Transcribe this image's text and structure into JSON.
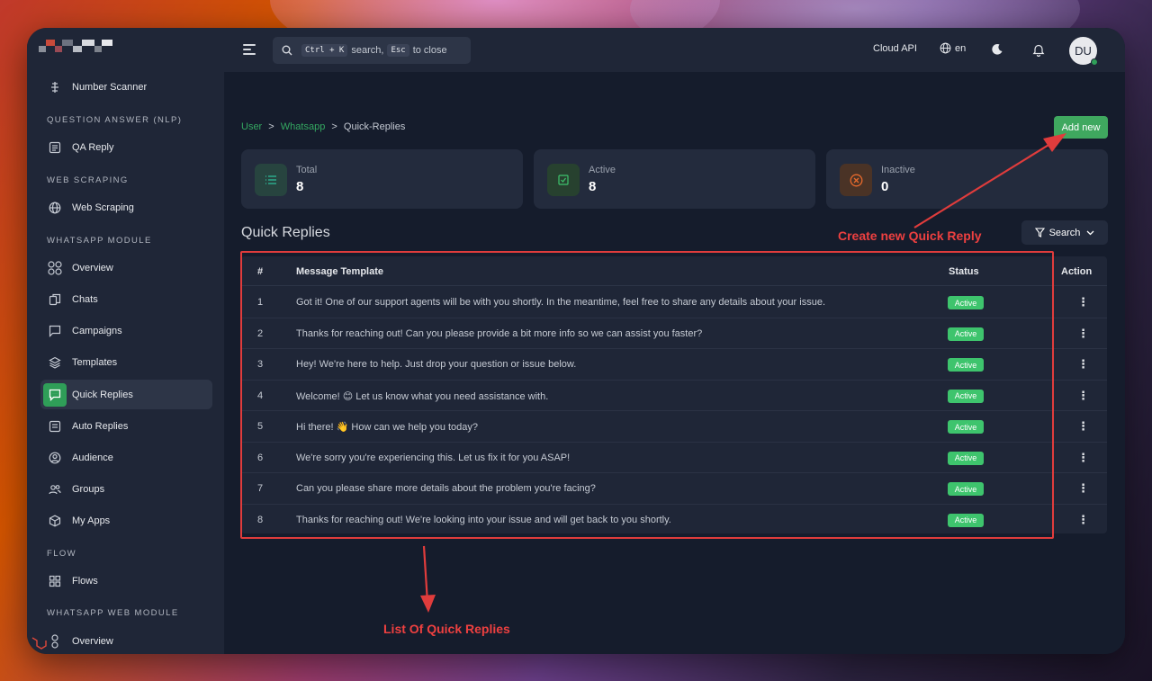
{
  "sidebar": {
    "items": [
      {
        "label": "Number Scanner",
        "icon": "scanner-icon"
      },
      {
        "label": "QA Reply",
        "icon": "document-icon"
      },
      {
        "label": "Web Scraping",
        "icon": "globe-icon"
      },
      {
        "label": "Overview",
        "icon": "grid-circles-icon"
      },
      {
        "label": "Chats",
        "icon": "chat-icon"
      },
      {
        "label": "Campaigns",
        "icon": "message-square-icon"
      },
      {
        "label": "Templates",
        "icon": "layers-icon"
      },
      {
        "label": "Quick Replies",
        "icon": "reply-icon"
      },
      {
        "label": "Auto Replies",
        "icon": "auto-reply-icon"
      },
      {
        "label": "Audience",
        "icon": "user-circle-icon"
      },
      {
        "label": "Groups",
        "icon": "users-icon"
      },
      {
        "label": "My Apps",
        "icon": "cube-icon"
      },
      {
        "label": "Flows",
        "icon": "grid-icon"
      },
      {
        "label": "Overview",
        "icon": "grid-circles-icon"
      }
    ],
    "headings": [
      "QUESTION ANSWER (NLP)",
      "WEB SCRAPING",
      "WHATSAPP MODULE",
      "FLOW",
      "WHATSAPP WEB MODULE"
    ]
  },
  "topbar": {
    "search_kbd1": "Ctrl + K",
    "search_text1": "search,",
    "search_kbd2": "Esc",
    "search_text2": "to close",
    "cloud_api": "Cloud API",
    "language": "en",
    "avatar": "DU"
  },
  "breadcrumb": {
    "user": "User",
    "whatsapp": "Whatsapp",
    "current": "Quick-Replies",
    "sep": ">"
  },
  "add_new": "Add new",
  "stats": [
    {
      "label": "Total",
      "value": "8",
      "color": "#2ec4a0"
    },
    {
      "label": "Active",
      "value": "8",
      "color": "#3ec46d"
    },
    {
      "label": "Inactive",
      "value": "0",
      "color": "#e86a2c"
    }
  ],
  "section_title": "Quick Replies",
  "filter_label": "Search",
  "table": {
    "headers": [
      "#",
      "Message Template",
      "Status",
      "Action"
    ],
    "rows": [
      {
        "num": "1",
        "msg": "Got it! One of our support agents will be with you shortly. In the meantime, feel free to share any details about your issue.",
        "status": "Active"
      },
      {
        "num": "2",
        "msg": "Thanks for reaching out! Can you please provide a bit more info so we can assist you faster?",
        "status": "Active"
      },
      {
        "num": "3",
        "msg": "Hey! We're here to help. Just drop your question or issue below.",
        "status": "Active"
      },
      {
        "num": "4",
        "msg": "Welcome! 😊 Let us know what you need assistance with.",
        "status": "Active"
      },
      {
        "num": "5",
        "msg": "Hi there! 👋 How can we help you today?",
        "status": "Active"
      },
      {
        "num": "6",
        "msg": "We're sorry you're experiencing this. Let us fix it for you ASAP!",
        "status": "Active"
      },
      {
        "num": "7",
        "msg": "Can you please share more details about the problem you're facing?",
        "status": "Active"
      },
      {
        "num": "8",
        "msg": "Thanks for reaching out! We're looking into your issue and will get back to you shortly.",
        "status": "Active"
      }
    ]
  },
  "annotations": {
    "create": "Create new Quick Reply",
    "list": "List Of Quick Replies"
  }
}
